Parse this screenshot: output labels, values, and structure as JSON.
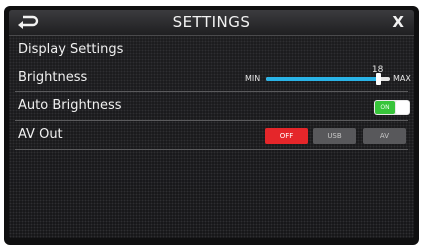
{
  "header": {
    "back_icon": "back-arrow-icon",
    "title": "SETTINGS",
    "close_label": "X"
  },
  "section": {
    "title": "Display Settings"
  },
  "brightness": {
    "label": "Brightness",
    "min_label": "MIN",
    "max_label": "MAX",
    "value": "18",
    "min": 0,
    "max": 20
  },
  "auto_brightness": {
    "label": "Auto Brightness",
    "state": "ON"
  },
  "av_out": {
    "label": "AV Out",
    "options": [
      "OFF",
      "USB",
      "AV"
    ],
    "selected": "OFF"
  },
  "colors": {
    "accent_blue": "#2ab3e6",
    "toggle_green": "#37c43a",
    "active_red": "#e5262a"
  }
}
